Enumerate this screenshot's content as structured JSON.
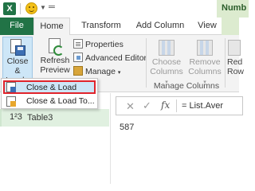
{
  "titlebar": {
    "app_icon": "excel-icon",
    "quick_access": [
      "smiley-feedback-icon",
      "dropdown-arrow-icon",
      "customize-icon"
    ],
    "context_tab_title": "Numb"
  },
  "tabs": [
    {
      "label": "File"
    },
    {
      "label": "Home"
    },
    {
      "label": "Transform"
    },
    {
      "label": "Add Column"
    },
    {
      "label": "View"
    }
  ],
  "ribbon": {
    "close_load": {
      "line1": "Close &",
      "line2": "Load",
      "arrow": "▾"
    },
    "refresh_preview": {
      "line1": "Refresh",
      "line2": "Preview",
      "arrow": "▾"
    },
    "properties_label": "Properties",
    "advanced_editor_label": "Advanced Editor",
    "manage_label": "Manage",
    "manage_arrow": "▾",
    "choose_columns": {
      "line1": "Choose",
      "line2": "Columns",
      "arrow": "▾"
    },
    "remove_columns": {
      "line1": "Remove",
      "line2": "Columns",
      "arrow": "▾"
    },
    "reduce_rows": {
      "line1": "Red",
      "line2": "Row"
    },
    "manage_columns_group": "Manage Columns"
  },
  "dropdown_menu": {
    "items": [
      {
        "label": "Close & Load",
        "highlighted": true
      },
      {
        "label": "Close & Load To..."
      }
    ]
  },
  "queries": [
    {
      "type_icon": "1²3",
      "name": "Table3"
    }
  ],
  "formula_bar": {
    "cancel": "✕",
    "confirm": "✓",
    "fx": "fx",
    "formula": "= List.Aver"
  },
  "result": {
    "value": "587"
  },
  "colors": {
    "excel_green": "#217346",
    "highlight_red": "#e0242c",
    "selected_blue": "#cde6f7",
    "query_selected": "#e0f0e0"
  }
}
